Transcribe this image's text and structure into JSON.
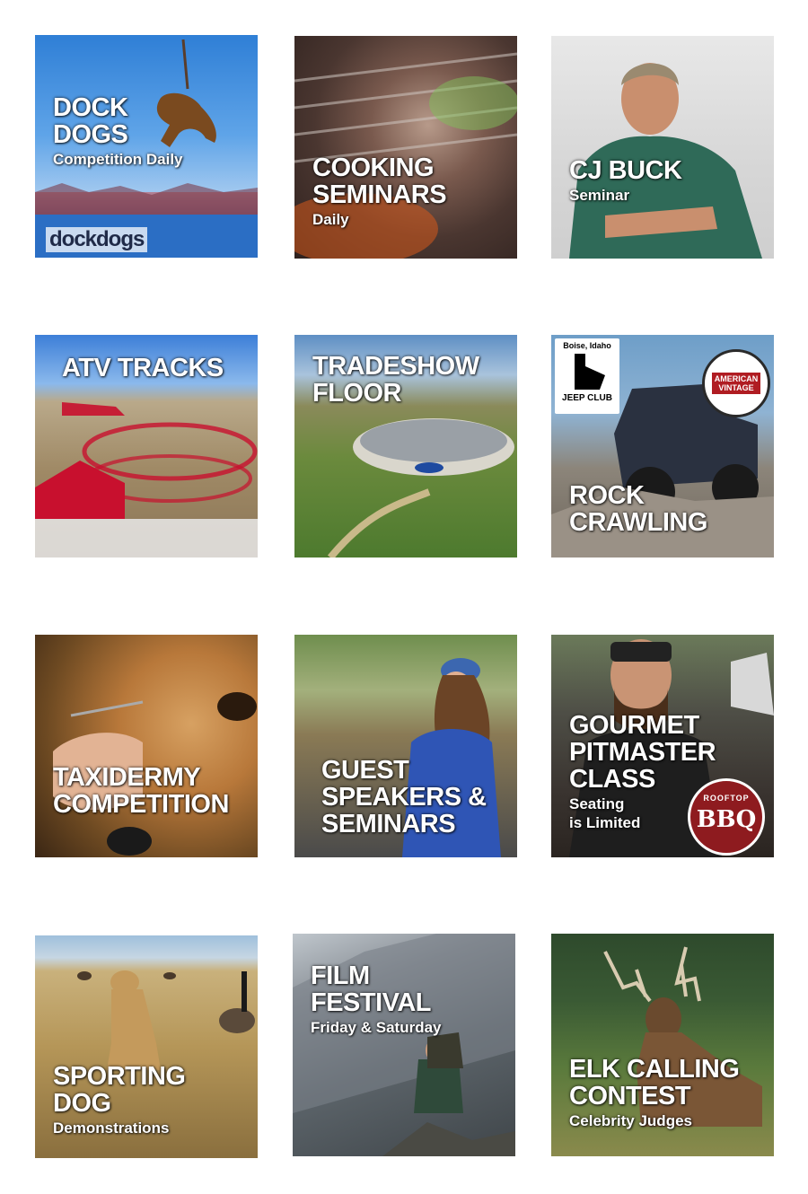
{
  "tiles": [
    {
      "id": "dock-dogs",
      "title": "DOCK\nDOGS",
      "subtitle": "Competition Daily",
      "logo": "dockdogs"
    },
    {
      "id": "cooking-seminars",
      "title": "COOKING\nSEMINARS",
      "subtitle": "Daily"
    },
    {
      "id": "cj-buck",
      "title": "CJ BUCK",
      "subtitle": "Seminar"
    },
    {
      "id": "atv-tracks",
      "title": "ATV TRACKS",
      "subtitle": ""
    },
    {
      "id": "tradeshow-floor",
      "title": "TRADESHOW\nFLOOR",
      "subtitle": ""
    },
    {
      "id": "rock-crawling",
      "title": "ROCK\nCRAWLING",
      "subtitle": "",
      "badge_left": "JEEP CLUB",
      "badge_left_top": "Boise, Idaho",
      "badge_right": "AMERICAN\nVINTAGE"
    },
    {
      "id": "taxidermy-competition",
      "title": "TAXIDERMY\nCOMPETITION",
      "subtitle": ""
    },
    {
      "id": "guest-speakers",
      "title": "GUEST\nSPEAKERS &\nSEMINARS",
      "subtitle": ""
    },
    {
      "id": "gourmet-pitmaster",
      "title": "GOURMET\nPITMASTER\nCLASS",
      "subtitle": "Seating\nis Limited",
      "badge_top": "ROOFTOP",
      "badge_main": "BBQ"
    },
    {
      "id": "sporting-dog",
      "title": "SPORTING\nDOG",
      "subtitle": "Demonstrations"
    },
    {
      "id": "film-festival",
      "title": "FILM\nFESTIVAL",
      "subtitle": "Friday & Saturday"
    },
    {
      "id": "elk-calling",
      "title": "ELK CALLING\nCONTEST",
      "subtitle": "Celebrity Judges"
    }
  ],
  "icons": [
    "dog-silhouette-icon",
    "elk-silhouette-icon",
    "jeep-silhouette-icon"
  ],
  "colors": {
    "text": "#ffffff",
    "bbq_red": "#8e1b1f",
    "atv_red": "#c8102e"
  }
}
